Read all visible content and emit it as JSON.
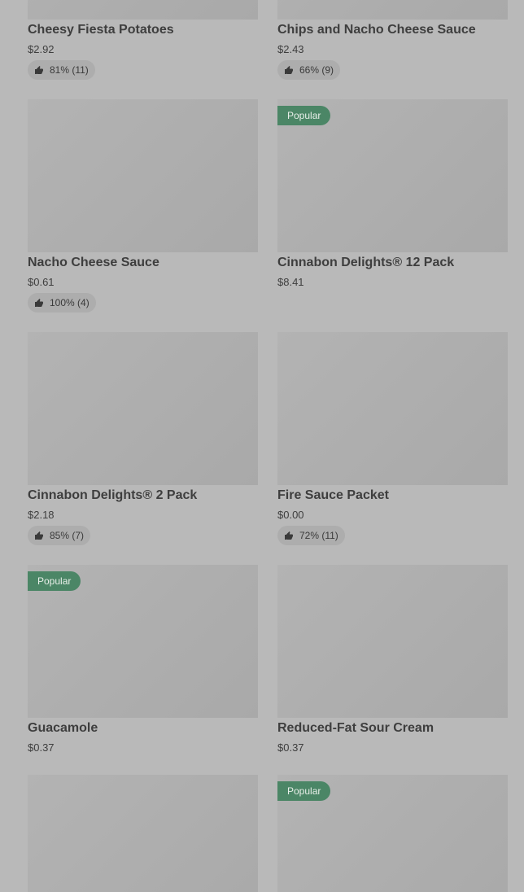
{
  "items": [
    {
      "name": "Cheesy Fiesta Potatoes",
      "price": "$2.92",
      "rating": "81% (11)"
    },
    {
      "name": "Chips and Nacho Cheese Sauce",
      "price": "$2.43",
      "rating": "66% (9)"
    },
    {
      "name": "Nacho Cheese Sauce",
      "price": "$0.61",
      "rating": "100% (4)"
    },
    {
      "name": "Cinnabon Delights® 12 Pack",
      "price": "$8.41",
      "badge": "Popular"
    },
    {
      "name": "Cinnabon Delights® 2 Pack",
      "price": "$2.18",
      "rating": "85% (7)"
    },
    {
      "name": "Fire Sauce Packet",
      "price": "$0.00",
      "rating": "72% (11)"
    },
    {
      "name": "Guacamole",
      "price": "$0.37",
      "badge": "Popular"
    },
    {
      "name": "Reduced-Fat Sour Cream",
      "price": "$0.37"
    },
    {},
    {
      "badge": "Popular"
    }
  ],
  "icons": {
    "rating": "thumbs-up-icon"
  }
}
